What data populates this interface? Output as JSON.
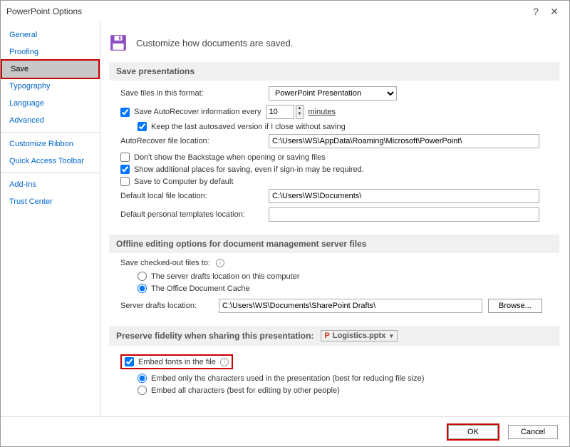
{
  "window": {
    "title": "PowerPoint Options"
  },
  "sidebar": {
    "items": [
      "General",
      "Proofing",
      "Save",
      "Typography",
      "Language",
      "Advanced",
      "Customize Ribbon",
      "Quick Access Toolbar",
      "Add-Ins",
      "Trust Center"
    ],
    "selected": "Save"
  },
  "intro": "Customize how documents are saved.",
  "sec_save": {
    "title": "Save presentations",
    "format_label": "Save files in this format:",
    "format_value": "PowerPoint Presentation",
    "autorecover_label_pre": "Save AutoRecover information every",
    "autorecover_value": "10",
    "autorecover_label_post": "minutes",
    "keep_last": "Keep the last autosaved version if I close without saving",
    "ar_loc_label": "AutoRecover file location:",
    "ar_loc_value": "C:\\Users\\WS\\AppData\\Roaming\\Microsoft\\PowerPoint\\",
    "dont_show": "Don't show the Backstage when opening or saving files",
    "show_additional": "Show additional places for saving, even if sign-in may be required.",
    "save_computer": "Save to Computer by default",
    "default_local_label": "Default local file location:",
    "default_local_value": "C:\\Users\\WS\\Documents\\",
    "default_tmpl_label": "Default personal templates location:",
    "default_tmpl_value": ""
  },
  "sec_offline": {
    "title": "Offline editing options for document management server files",
    "save_checked_label": "Save checked-out files to:",
    "opt1": "The server drafts location on this computer",
    "opt2": "The Office Document Cache",
    "drafts_label": "Server drafts location:",
    "drafts_value": "C:\\Users\\WS\\Documents\\SharePoint Drafts\\",
    "browse": "Browse..."
  },
  "sec_fidelity": {
    "title": "Preserve fidelity when sharing this presentation:",
    "file": "Logistics.pptx",
    "embed": "Embed fonts in the file",
    "opt1": "Embed only the characters used in the presentation (best for reducing file size)",
    "opt2": "Embed all characters (best for editing by other people)"
  },
  "footer": {
    "ok": "OK",
    "cancel": "Cancel"
  }
}
